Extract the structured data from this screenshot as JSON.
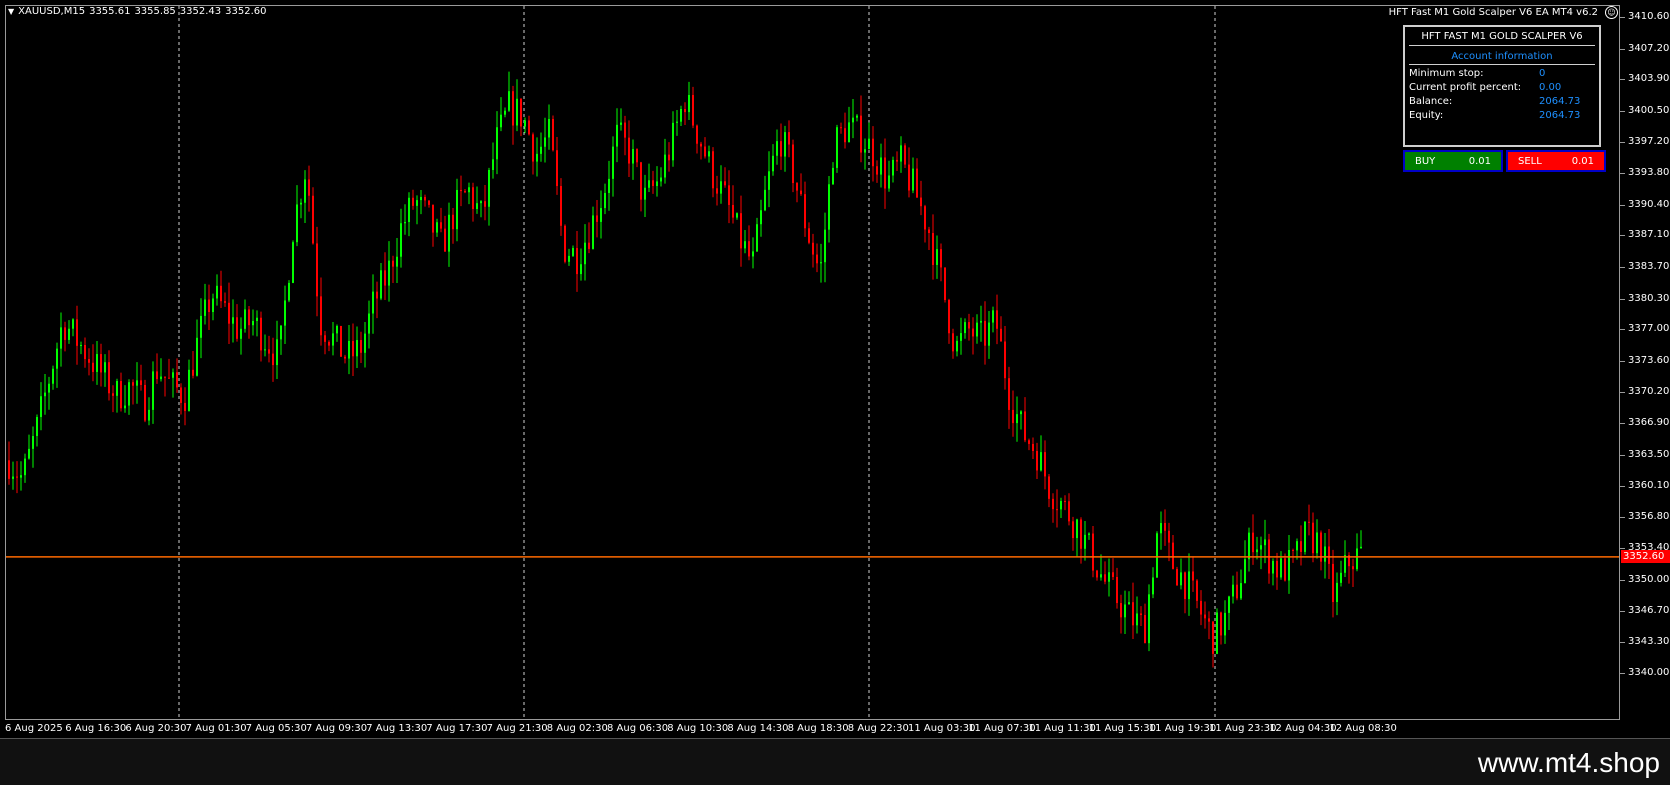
{
  "colors": {
    "bull": "#00ff00",
    "bear": "#ff0000",
    "grid": "#cfcfcf",
    "bid_line": "#ff6a00",
    "panel_text": "#1e90ff",
    "buy_bg": "#008000",
    "sell_bg": "#ff0000"
  },
  "header": {
    "arrow_icon": "triangle-down-icon",
    "symbol": "XAUUSD,M15",
    "open": "3355.61",
    "high": "3355.85",
    "low": "3352.43",
    "close": "3352.60"
  },
  "ea": {
    "title": "HFT Fast M1 Gold Scalper V6 EA MT4 v6.2",
    "icon": "smiley-icon",
    "panel_title": "HFT FAST M1 GOLD SCALPER V6",
    "panel_subtitle": "Account information",
    "rows": [
      {
        "label": "Minimum stop:",
        "value": "0"
      },
      {
        "label": "Current profit percent:",
        "value": "0.00"
      },
      {
        "label": "Balance:",
        "value": "2064.73"
      },
      {
        "label": "Equity:",
        "value": "2064.73"
      }
    ],
    "buy_label": "BUY",
    "buy_lot": "0.01",
    "sell_label": "SELL",
    "sell_lot": "0.01"
  },
  "price_axis": {
    "ticks": [
      "3410.60",
      "3407.20",
      "3403.90",
      "3400.50",
      "3397.20",
      "3393.80",
      "3390.40",
      "3387.10",
      "3383.70",
      "3380.30",
      "3377.00",
      "3373.60",
      "3370.20",
      "3366.90",
      "3363.50",
      "3360.10",
      "3356.80",
      "3353.40",
      "3350.00",
      "3346.70",
      "3343.30",
      "3340.00"
    ],
    "current_price": "3352.60"
  },
  "time_axis": {
    "labels": [
      "6 Aug 2025",
      "6 Aug 16:30",
      "6 Aug 20:30",
      "7 Aug 01:30",
      "7 Aug 05:30",
      "7 Aug 09:30",
      "7 Aug 13:30",
      "7 Aug 17:30",
      "7 Aug 21:30",
      "8 Aug 02:30",
      "8 Aug 06:30",
      "8 Aug 10:30",
      "8 Aug 14:30",
      "8 Aug 18:30",
      "8 Aug 22:30",
      "11 Aug 03:30",
      "11 Aug 07:30",
      "11 Aug 11:30",
      "11 Aug 15:30",
      "11 Aug 19:30",
      "11 Aug 23:30",
      "12 Aug 04:30",
      "12 Aug 08:30"
    ]
  },
  "chart_data": {
    "type": "candlestick",
    "ylim": [
      3340.0,
      3410.6
    ],
    "bid": 3352.6,
    "path": [
      3363,
      3361,
      3366,
      3372,
      3378,
      3376,
      3374,
      3372,
      3370,
      3371,
      3369,
      3373,
      3371,
      3370,
      3376,
      3381,
      3379,
      3377,
      3378,
      3376,
      3374,
      3388,
      3395,
      3378,
      3376,
      3374,
      3375,
      3380,
      3383,
      3388,
      3391,
      3389,
      3386,
      3390,
      3392,
      3389,
      3397,
      3401,
      3400,
      3396,
      3398,
      3386,
      3385,
      3388,
      3392,
      3398,
      3396,
      3391,
      3393,
      3397,
      3402,
      3398,
      3394,
      3391,
      3387,
      3384,
      3392,
      3398,
      3394,
      3388,
      3383,
      3397,
      3399,
      3398,
      3396,
      3393,
      3395,
      3392,
      3388,
      3382,
      3375,
      3377,
      3376,
      3378,
      3370,
      3366,
      3364,
      3360,
      3358,
      3356,
      3353,
      3350,
      3348,
      3346,
      3345,
      3356,
      3352,
      3350,
      3347,
      3344,
      3346,
      3350,
      3355,
      3353,
      3351,
      3352,
      3355,
      3354,
      3348,
      3352,
      3353
    ]
  },
  "footer": {
    "watermark": "www.mt4.shop"
  }
}
